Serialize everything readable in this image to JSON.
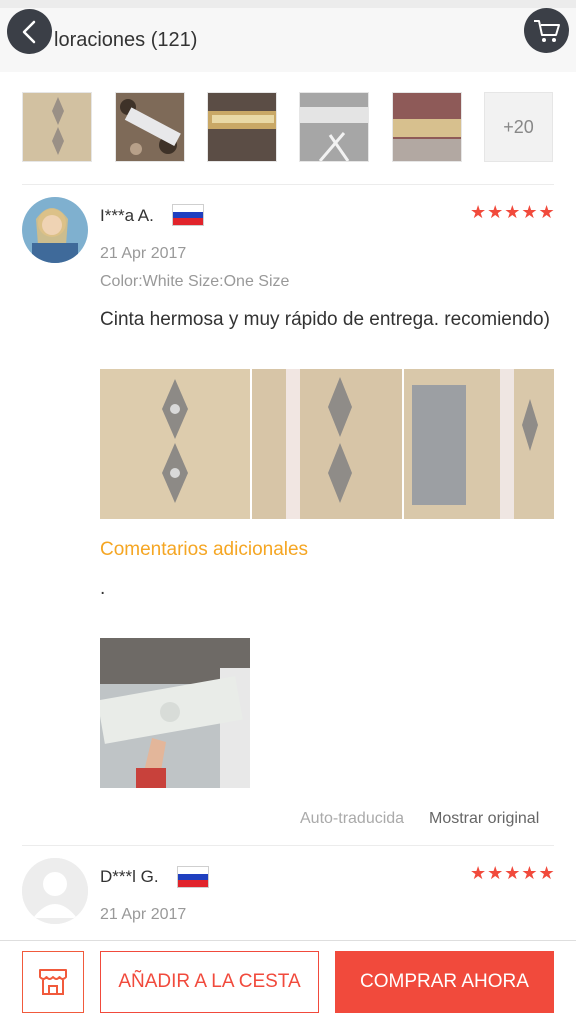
{
  "header": {
    "title": "loraciones (121)",
    "back_icon": "chevron-left-icon",
    "cart_icon": "cart-icon"
  },
  "thumbnails": {
    "more_label": "+20"
  },
  "reviews": [
    {
      "name": "I***a A.",
      "country_flag": "russia-flag",
      "stars": "★★★★★",
      "date": "21 Apr 2017",
      "sku": "Color:White Size:One Size",
      "comment": "Cinta hermosa y muy rápido de entrega. recomiendo)",
      "additional_title": "Comentarios adicionales",
      "additional_text": ".",
      "auto_translated": "Auto-traducida",
      "show_original": "Mostrar original"
    },
    {
      "name": "D***l G.",
      "country_flag": "russia-flag",
      "stars": "★★★★★",
      "date": "21 Apr 2017"
    }
  ],
  "bottom_bar": {
    "store_icon": "store-icon",
    "add_to_cart_label": "AÑADIR A LA CESTA",
    "buy_now_label": "COMPRAR AHORA"
  },
  "colors": {
    "accent": "#f14a3c",
    "highlight": "#f5a623",
    "dark_button": "#3b3f47"
  }
}
